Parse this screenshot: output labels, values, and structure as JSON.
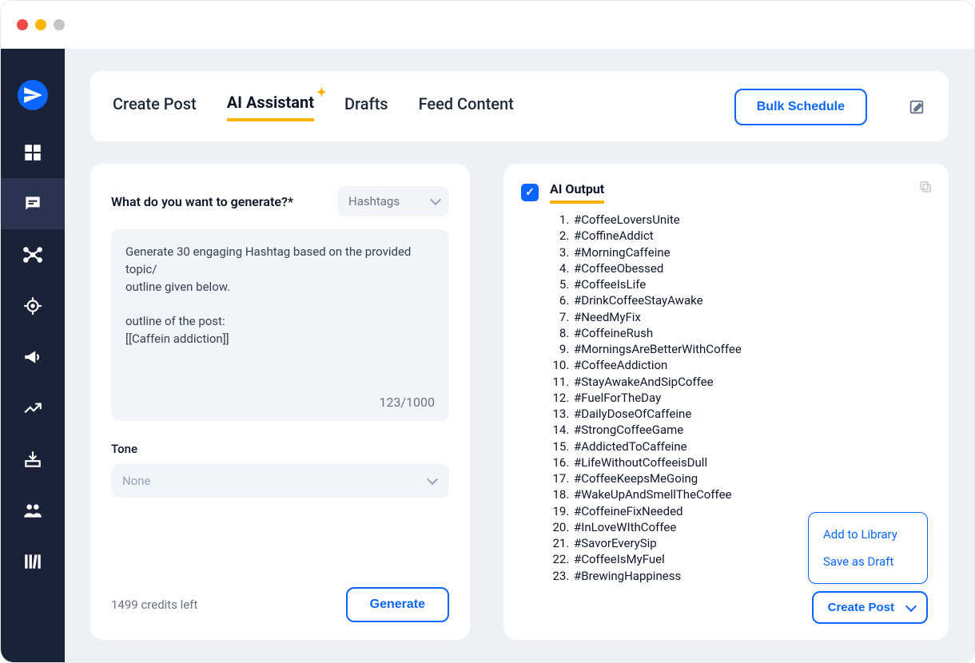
{
  "tabs": {
    "create_post": "Create Post",
    "ai_assistant": "AI Assistant",
    "drafts": "Drafts",
    "feed_content": "Feed Content"
  },
  "actions": {
    "bulk_schedule": "Bulk Schedule",
    "generate": "Generate",
    "create_post": "Create Post",
    "add_to_library": "Add to Library",
    "save_as_draft": "Save as Draft"
  },
  "left_panel": {
    "question_label": "What do you want to generate?*",
    "type_select": "Hashtags",
    "prompt_text": "Generate 30 engaging Hashtag based on the provided topic/\noutline given below.\n\noutline of the post:\n[[Caffein addiction]]",
    "char_count": "123/1000",
    "tone_label": "Tone",
    "tone_value": "None",
    "credits": "1499 credits left"
  },
  "right_panel": {
    "title": "AI Output",
    "hashtags": [
      "#CoffeeLoversUnite",
      "#CoffineAddict",
      "#MorningCaffeine",
      "#CoffeeObessed",
      "#CoffeeIsLife",
      "#DrinkCoffeeStayAwake",
      "#NeedMyFix",
      "#CoffeineRush",
      "#MorningsAreBetterWithCoffee",
      "#CoffeeAddiction",
      "#StayAwakeAndSipCoffee",
      "#FuelForTheDay",
      "#DailyDoseOfCaffeine",
      "#StrongCoffeeGame",
      "#AddictedToCaffeine",
      "#LifeWithoutCoffeeisDull",
      "#CoffeeKeepsMeGoing",
      "#WakeUpAndSmellTheCoffee",
      "#CoffeineFixNeeded",
      "#InLoveWIthCoffee",
      "#SavorEverySip",
      "#CoffeeIsMyFuel",
      "#BrewingHappiness"
    ]
  }
}
